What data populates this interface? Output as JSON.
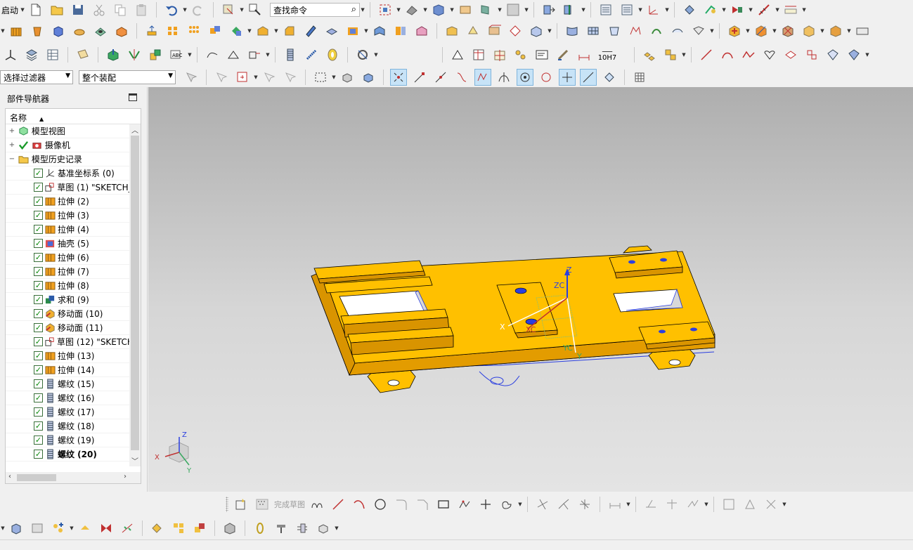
{
  "toolbar": {
    "start_label": "启动",
    "search_placeholder": "查找命令",
    "selection_filter": "选择过滤器",
    "assembly_scope": "整个装配",
    "tolerance_label": "10H7",
    "sketch_finish_label": "完成草图"
  },
  "navigator": {
    "title": "部件导航器",
    "column_name": "名称",
    "groups": [
      {
        "label": "模型视图",
        "icon": "model-views-icon"
      },
      {
        "label": "摄像机",
        "icon": "camera-icon"
      },
      {
        "label": "模型历史记录",
        "icon": "folder-open-icon"
      }
    ],
    "features": [
      {
        "label": "基准坐标系 (0)",
        "icon": "datum-csys-icon",
        "bold": false
      },
      {
        "label": "草图 (1) \"SKETCH_",
        "icon": "sketch-icon",
        "bold": false
      },
      {
        "label": "拉伸 (2)",
        "icon": "extrude-icon",
        "bold": false
      },
      {
        "label": "拉伸 (3)",
        "icon": "extrude-icon",
        "bold": false,
        "info": true
      },
      {
        "label": "拉伸 (4)",
        "icon": "extrude-icon",
        "bold": false
      },
      {
        "label": "抽壳 (5)",
        "icon": "shell-icon",
        "bold": false
      },
      {
        "label": "拉伸 (6)",
        "icon": "extrude-icon",
        "bold": false
      },
      {
        "label": "拉伸 (7)",
        "icon": "extrude-icon",
        "bold": false
      },
      {
        "label": "拉伸 (8)",
        "icon": "extrude-icon",
        "bold": false
      },
      {
        "label": "求和 (9)",
        "icon": "unite-icon",
        "bold": false
      },
      {
        "label": "移动面 (10)",
        "icon": "move-face-icon",
        "bold": false
      },
      {
        "label": "移动面 (11)",
        "icon": "move-face-icon",
        "bold": false
      },
      {
        "label": "草图 (12) \"SKETCH",
        "icon": "sketch-icon",
        "bold": false
      },
      {
        "label": "拉伸 (13)",
        "icon": "extrude-icon",
        "bold": false
      },
      {
        "label": "拉伸 (14)",
        "icon": "extrude-icon",
        "bold": false
      },
      {
        "label": "螺纹 (15)",
        "icon": "thread-icon",
        "bold": false
      },
      {
        "label": "螺纹 (16)",
        "icon": "thread-icon",
        "bold": false
      },
      {
        "label": "螺纹 (17)",
        "icon": "thread-icon",
        "bold": false
      },
      {
        "label": "螺纹 (18)",
        "icon": "thread-icon",
        "bold": false
      },
      {
        "label": "螺纹 (19)",
        "icon": "thread-icon",
        "bold": false
      },
      {
        "label": "螺纹 (20)",
        "icon": "thread-icon",
        "bold": true
      }
    ]
  },
  "viewport": {
    "part_color": "#ffc000",
    "edge_color": "#000000",
    "sketch_color": "#2b3fe0",
    "csys_labels": {
      "zc": "ZC",
      "yc": "YC",
      "xc": "XC",
      "x": "X",
      "y": "Y",
      "z": "Z"
    },
    "triad_labels": {
      "x": "X",
      "y": "Y",
      "z": "Z"
    }
  }
}
